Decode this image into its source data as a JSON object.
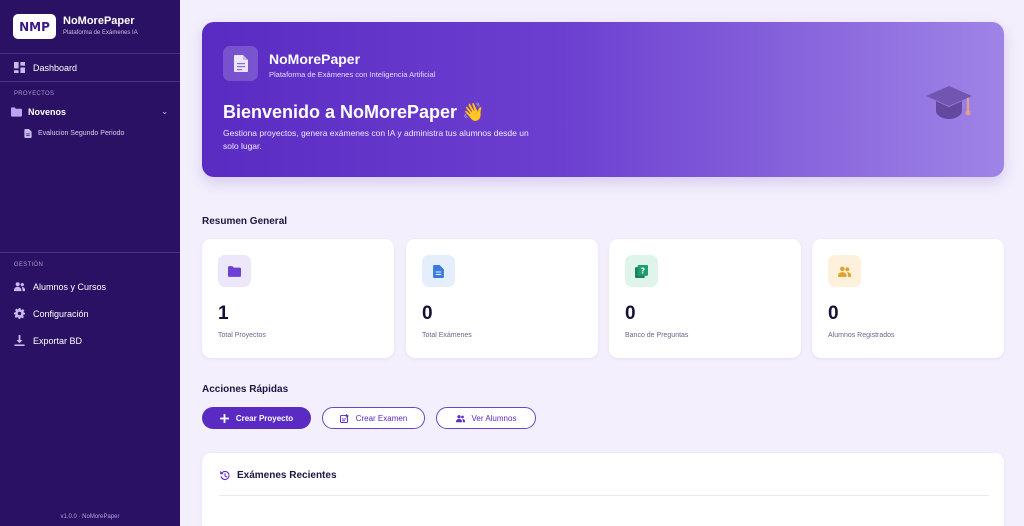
{
  "brand": {
    "logo": "NMP",
    "name": "NoMorePaper",
    "subtitle": "Plataforma de Exámenes IA"
  },
  "sidebar": {
    "dashboard": {
      "label": "Dashboard",
      "icon": "dashboard-icon"
    },
    "projects_section": "PROYECTOS",
    "project": {
      "label": "Novenos",
      "icon": "folder-icon"
    },
    "subitem": {
      "label": "Evalucion Segundo Periodo",
      "icon": "document-icon"
    },
    "management_section": "GESTIÓN",
    "items": [
      {
        "label": "Alumnos y Cursos",
        "icon": "users-icon"
      },
      {
        "label": "Configuración",
        "icon": "gear-icon"
      },
      {
        "label": "Exportar BD",
        "icon": "download-icon"
      }
    ],
    "version": "v1.0.0 · NoMorePaper"
  },
  "hero": {
    "name": "NoMorePaper",
    "subtitle": "Plataforma de Exámenes con Inteligencia Artificial",
    "title": "Bienvenido a NoMorePaper 👋",
    "description": "Gestiona proyectos, genera exámenes con IA y administra tus alumnos desde un solo lugar."
  },
  "summary": {
    "title": "Resumen General",
    "cards": [
      {
        "value": "1",
        "label": "Total Proyectos",
        "icon": "folder-icon",
        "color": "#6d3fd6",
        "bg": "#ede7fb"
      },
      {
        "value": "0",
        "label": "Total Exámenes",
        "icon": "document-icon",
        "color": "#3b7be0",
        "bg": "#e4eefc"
      },
      {
        "value": "0",
        "label": "Banco de Preguntas",
        "icon": "question-bank-icon",
        "color": "#1f9e6d",
        "bg": "#dff5ec"
      },
      {
        "value": "0",
        "label": "Alumnos Registrados",
        "icon": "users-icon",
        "color": "#e0a12b",
        "bg": "#fdf1dc"
      }
    ]
  },
  "actions": {
    "title": "Acciones Rápidas",
    "create_project": "Crear Proyecto",
    "create_exam": "Crear Examen",
    "view_students": "Ver Alumnos"
  },
  "recent": {
    "title": "Exámenes Recientes",
    "icon": "history-icon"
  },
  "colors": {
    "sidebar": "#2a1163",
    "accent": "#5a2bc2",
    "background": "#f3effc"
  }
}
